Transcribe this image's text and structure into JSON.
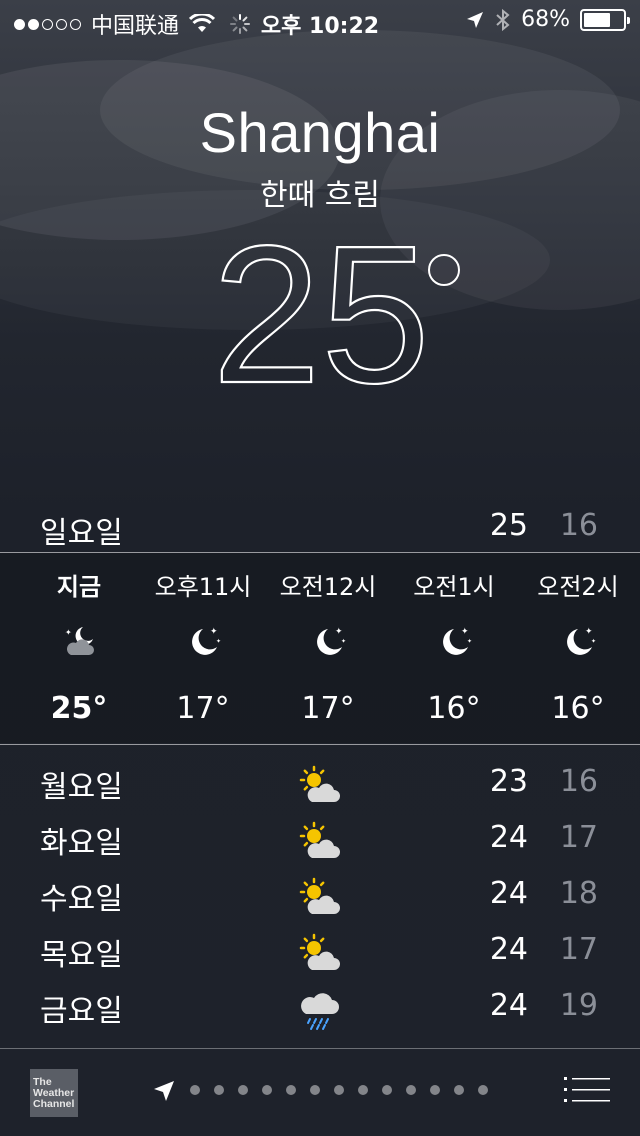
{
  "status_bar": {
    "signal_dots_on": 2,
    "signal_dots_total": 5,
    "carrier": "中国联通",
    "time": "오후 10:22",
    "battery_text": "68%",
    "battery_level": 0.68
  },
  "header": {
    "city": "Shanghai",
    "condition": "한때 흐림",
    "temperature": "25"
  },
  "today": {
    "day": "일요일",
    "high": "25",
    "low": "16"
  },
  "hourly": [
    {
      "label": "지금",
      "icon": "partly-cloudy-night-icon",
      "temp": "25°"
    },
    {
      "label": "오후11시",
      "icon": "moon-stars-icon",
      "temp": "17°"
    },
    {
      "label": "오전12시",
      "icon": "moon-stars-icon",
      "temp": "17°"
    },
    {
      "label": "오전1시",
      "icon": "moon-stars-icon",
      "temp": "16°"
    },
    {
      "label": "오전2시",
      "icon": "moon-stars-icon",
      "temp": "16°"
    }
  ],
  "daily": [
    {
      "day": "월요일",
      "icon": "partly-sunny-icon",
      "high": "23",
      "low": "16"
    },
    {
      "day": "화요일",
      "icon": "partly-sunny-icon",
      "high": "24",
      "low": "17"
    },
    {
      "day": "수요일",
      "icon": "partly-sunny-icon",
      "high": "24",
      "low": "18"
    },
    {
      "day": "목요일",
      "icon": "partly-sunny-icon",
      "high": "24",
      "low": "17"
    },
    {
      "day": "금요일",
      "icon": "rain-icon",
      "high": "24",
      "low": "19"
    }
  ],
  "bottom_bar": {
    "provider_logo_text": "The Weather Channel",
    "page_count": 13
  },
  "colors": {
    "background": "#1e222b",
    "secondary_text": "#8b8f98"
  }
}
